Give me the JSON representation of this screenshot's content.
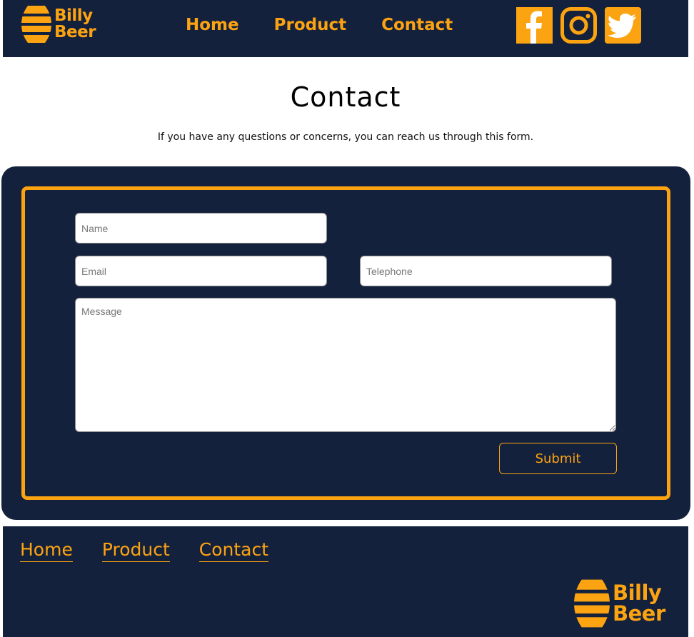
{
  "brand": {
    "line1": "Billy",
    "line2": "Beer",
    "accent": "#fca311",
    "navy": "#14213d"
  },
  "header": {
    "nav": [
      "Home",
      "Product",
      "Contact"
    ],
    "social_icons": [
      "facebook-icon",
      "instagram-icon",
      "twitter-icon"
    ]
  },
  "main": {
    "title": "Contact",
    "subtitle": "If you have any questions or concerns, you can reach us through this form."
  },
  "form": {
    "name_placeholder": "Name",
    "email_placeholder": "Email",
    "telephone_placeholder": "Telephone",
    "message_placeholder": "Message",
    "submit_label": "Submit"
  },
  "footer": {
    "nav": [
      "Home",
      "Product",
      "Contact"
    ]
  }
}
